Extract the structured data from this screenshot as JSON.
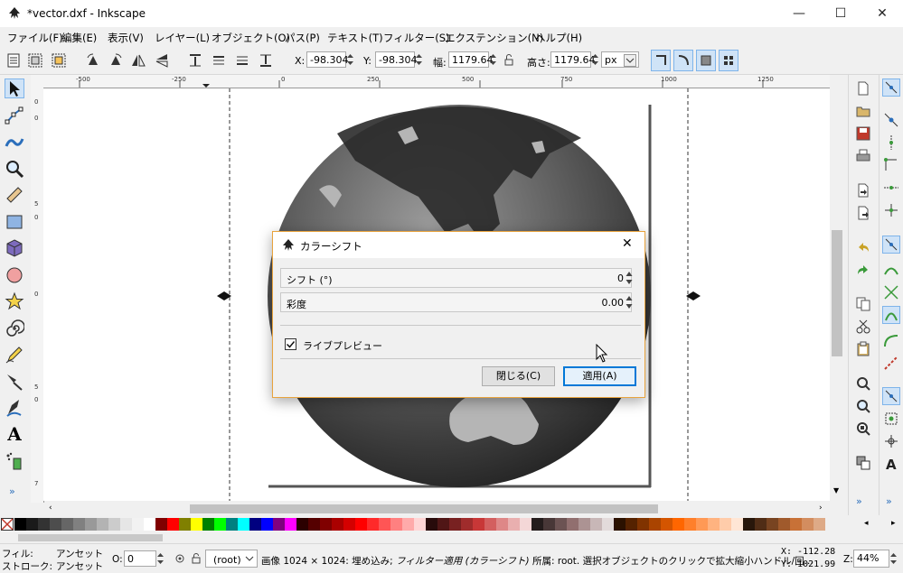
{
  "window": {
    "title": "*vector.dxf - Inkscape",
    "minimize": "—",
    "maximize": "☐",
    "close": "✕"
  },
  "menu": [
    "ファイル(F)",
    "編集(E)",
    "表示(V)",
    "レイヤー(L)",
    "オブジェクト(O)",
    "パス(P)",
    "テキスト(T)",
    "フィルター(S)",
    "エクステンション(N)",
    "ヘルプ(H)"
  ],
  "toolbar": {
    "x_label": "X:",
    "x_value": "-98.304",
    "y_label": "Y:",
    "y_value": "-98.304",
    "w_label": "幅:",
    "w_value": "1179.64",
    "h_label": "高さ:",
    "h_value": "1179.64",
    "unit": "px"
  },
  "ruler": {
    "h_ticks": [
      "-500",
      "-250",
      "0",
      "250",
      "500",
      "750",
      "1000",
      "1250"
    ],
    "v_ticks": [
      "0",
      "0",
      "5",
      "0",
      "0",
      "5",
      "0",
      "7"
    ]
  },
  "dialog": {
    "title": "カラーシフト",
    "close": "✕",
    "shift_label": "シフト (°)",
    "shift_value": "0",
    "saturation_label": "彩度",
    "saturation_value": "0.00",
    "live_preview_label": "ライブプレビュー",
    "live_preview_checked": true,
    "close_button": "閉じる(C)",
    "apply_button": "適用(A)"
  },
  "palette": {
    "colors": [
      "#000000",
      "#1a1a1a",
      "#333333",
      "#4d4d4d",
      "#666666",
      "#808080",
      "#999999",
      "#b3b3b3",
      "#cccccc",
      "#e6e6e6",
      "#f2f2f2",
      "#ffffff",
      "#800000",
      "#ff0000",
      "#808000",
      "#ffff00",
      "#008000",
      "#00ff00",
      "#008080",
      "#00ffff",
      "#000080",
      "#0000ff",
      "#800080",
      "#ff00ff",
      "#2b0000",
      "#550000",
      "#800000",
      "#aa0000",
      "#d40000",
      "#ff0000",
      "#ff2a2a",
      "#ff5555",
      "#ff8080",
      "#ffaaaa",
      "#ffd5d5",
      "#280b0b",
      "#501616",
      "#782121",
      "#a02c2c",
      "#c83737",
      "#d35f5f",
      "#de8787",
      "#e9afaf",
      "#f4d7d7",
      "#241c1c",
      "#483737",
      "#6c5353",
      "#916f6f",
      "#ac9393",
      "#c8b7b7",
      "#e3dbdb",
      "#2b1100",
      "#552200",
      "#803300",
      "#aa4400",
      "#d45500",
      "#ff6600",
      "#ff7f2a",
      "#ff9955",
      "#ffb380",
      "#ffccaa",
      "#ffe6d5",
      "#28170b",
      "#502d16",
      "#784421",
      "#a05a2c",
      "#c87137",
      "#d38d5f",
      "#deaa87"
    ]
  },
  "status": {
    "fill_label": "フィル:",
    "fill_value": "アンセット",
    "stroke_label": "ストローク:",
    "stroke_value": "アンセット",
    "opacity_label": "O:",
    "opacity_value": "0",
    "layer": "(root)",
    "message_plain": "画像 1024 × 1024: 埋め込み; ",
    "message_italic": "フィルター適用 (カラーシフト)",
    "message_rest": " 所属: root. 選択オブジェクトのクリックで拡大縮小ハンドル/回...",
    "x_coord": "X: -112.28",
    "y_coord": "Y: 1021.99",
    "zoom_label": "Z:",
    "zoom_value": "44%"
  },
  "colors": {
    "accent": "#e8a33d",
    "selection": "#7eb4ea",
    "primary_button_border": "#0078d7"
  }
}
